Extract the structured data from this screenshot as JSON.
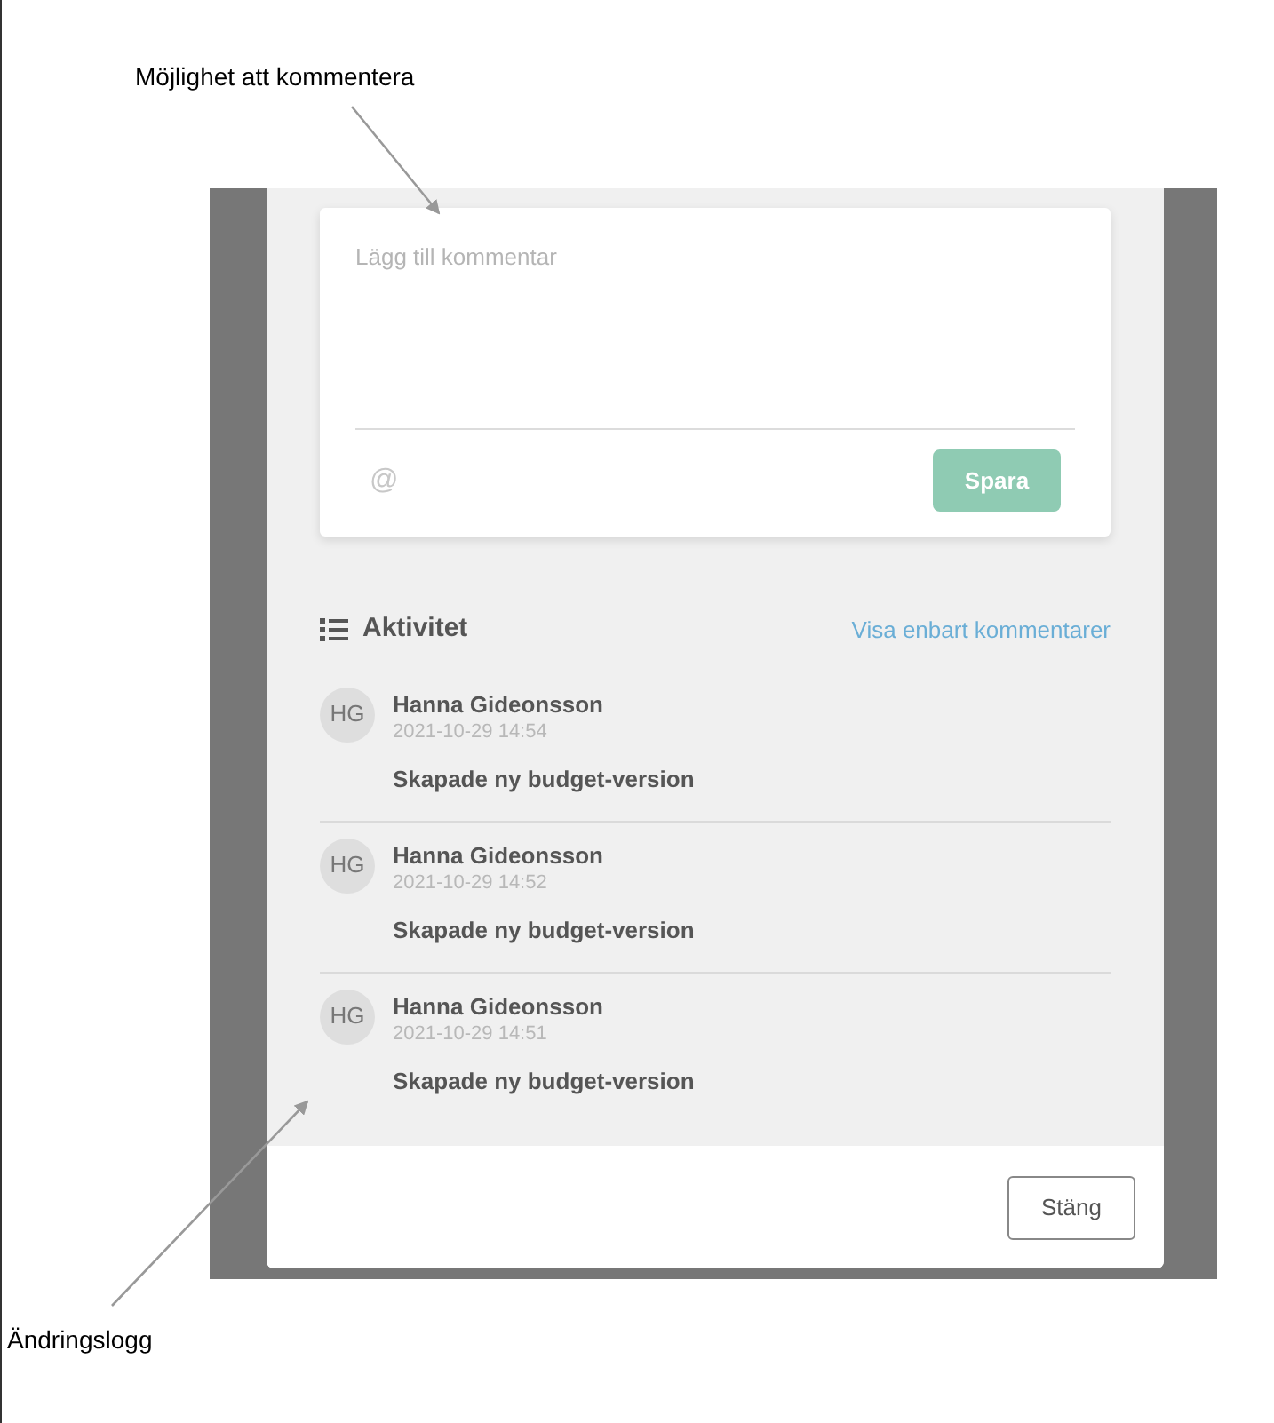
{
  "annotations": [
    {
      "kind": "top",
      "text": "Möjlighet att kommentera"
    },
    {
      "kind": "bottom",
      "text": "Ändringslogg"
    }
  ],
  "comment_box": {
    "placeholder": "Lägg till kommentar",
    "mention_symbol": "@",
    "save_button": "Spara"
  },
  "activity": {
    "title": "Aktivitet",
    "filter_link": "Visa enbart kommentarer",
    "entries": [
      {
        "initials": "HG",
        "name": "Hanna Gideonsson",
        "time": "2021-10-29 14:54",
        "action": "Skapade ny budget-version"
      },
      {
        "initials": "HG",
        "name": "Hanna Gideonsson",
        "time": "2021-10-29 14:52",
        "action": "Skapade ny budget-version"
      },
      {
        "initials": "HG",
        "name": "Hanna Gideonsson",
        "time": "2021-10-29 14:51",
        "action": "Skapade ny budget-version"
      }
    ]
  },
  "close_button": "Stäng"
}
